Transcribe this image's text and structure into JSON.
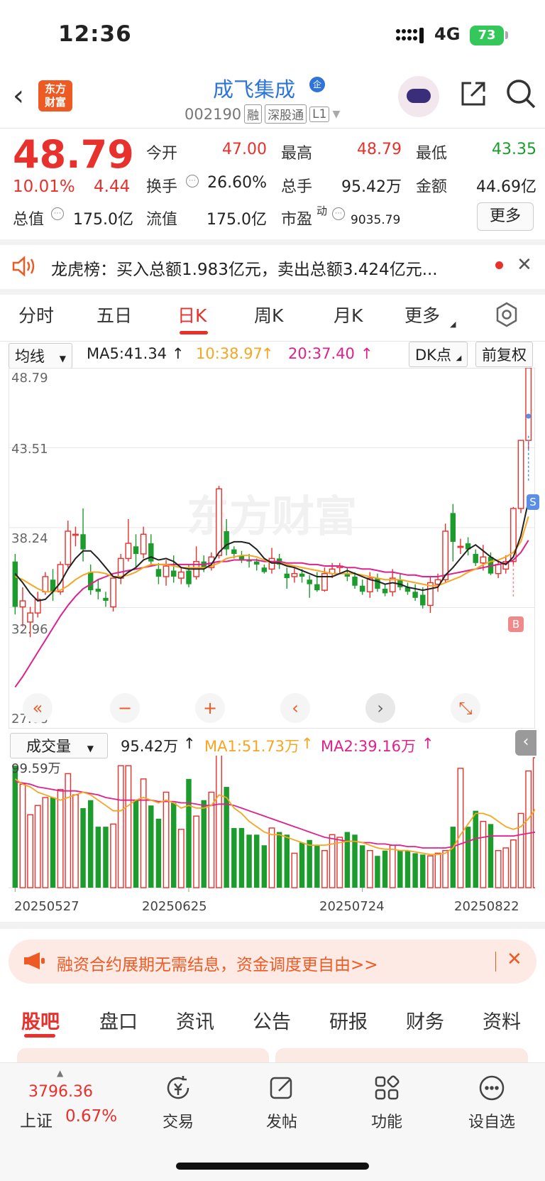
{
  "status_bar": {
    "time": "12:36",
    "network": "4G",
    "battery": "73"
  },
  "header": {
    "back": "‹",
    "logo_line1": "东方",
    "logo_line2": "财富",
    "stock_name": "成飞集成",
    "cert_badge": "企",
    "code": "002190",
    "tags": [
      "融",
      "深股通",
      "L1"
    ]
  },
  "quote": {
    "price": "48.79",
    "change_pct": "10.01%",
    "change": "4.44",
    "open_label": "今开",
    "open": "47.00",
    "high_label": "最高",
    "high": "48.79",
    "low_label": "最低",
    "low": "43.35",
    "turnover_label": "换手",
    "turnover": "26.60%",
    "volume_label": "总手",
    "volume": "95.42万",
    "amount_label": "金额",
    "amount": "44.69亿",
    "mktcap_label": "总值",
    "mktcap": "175.0亿",
    "float_label": "流值",
    "float": "175.0亿",
    "pe_label": "市盈",
    "pe_sup": "动",
    "pe": "9035.79",
    "more": "更多"
  },
  "notice": {
    "text": "龙虎榜：买入总额1.983亿元，卖出总额3.424亿元..."
  },
  "period_tabs": [
    "分时",
    "五日",
    "日K",
    "周K",
    "月K",
    "更多"
  ],
  "active_period": "日K",
  "ma_row": {
    "selector": "均线",
    "ma5": "MA5:41.34",
    "ma10": "10:38.97",
    "ma20": "20:37.40",
    "dk": "DK点",
    "adjust": "前复权",
    "colors": {
      "ma5": "#222222",
      "ma10": "#f5a623",
      "ma20": "#e0208c"
    }
  },
  "price_axis": [
    "48.79",
    "43.51",
    "38.24",
    "32.96",
    "27.68"
  ],
  "vol_row": {
    "selector": "成交量",
    "vol": "95.42万",
    "ma1": "MA1:51.73万",
    "ma2": "MA2:39.16万",
    "max_label": "99.59万"
  },
  "date_axis": [
    "20250527",
    "20250625",
    "20250724",
    "20250822"
  ],
  "markers": {
    "sell": "S",
    "buy": "B"
  },
  "controls": [
    "«",
    "−",
    "+",
    "‹",
    "›",
    "⤡"
  ],
  "ad": {
    "text": "融资合约展期无需结息，资金调度更自由>>"
  },
  "bottom_tabs": [
    "股吧",
    "盘口",
    "资讯",
    "公告",
    "研报",
    "财务",
    "资料"
  ],
  "footer": {
    "index_value": "3796.36",
    "index_name": "上证",
    "index_pct": "0.67%",
    "items": [
      {
        "label": "交易",
        "icon": "trade-icon"
      },
      {
        "label": "发帖",
        "icon": "post-icon"
      },
      {
        "label": "功能",
        "icon": "apps-icon"
      },
      {
        "label": "设自选",
        "icon": "more-dots-icon"
      }
    ]
  },
  "chart_data": {
    "type": "candlestick",
    "ylim": [
      27.68,
      48.79
    ],
    "colors": {
      "up": "#e8302c",
      "down": "#1c9c2c"
    },
    "ohlc": [
      [
        36.0,
        36.5,
        32.5,
        33.0
      ],
      [
        33.0,
        34.3,
        31.7,
        33.4
      ],
      [
        32.0,
        33.0,
        31.0,
        32.6
      ],
      [
        32.6,
        34.0,
        32.3,
        33.5
      ],
      [
        34.0,
        35.3,
        33.8,
        35.0
      ],
      [
        34.8,
        35.5,
        33.4,
        34.0
      ],
      [
        34.0,
        36.0,
        33.8,
        35.8
      ],
      [
        35.8,
        38.7,
        35.6,
        38.0
      ],
      [
        37.8,
        38.3,
        37.0,
        37.8
      ],
      [
        37.8,
        39.5,
        36.0,
        36.8
      ],
      [
        35.3,
        35.8,
        33.8,
        34.1
      ],
      [
        34.2,
        34.8,
        33.5,
        34.0
      ],
      [
        33.6,
        34.0,
        33.0,
        33.4
      ],
      [
        33.0,
        34.9,
        32.7,
        34.9
      ],
      [
        34.9,
        36.5,
        34.5,
        36.2
      ],
      [
        36.2,
        38.8,
        36.0,
        37.2
      ],
      [
        37.0,
        37.8,
        35.6,
        36.5
      ],
      [
        36.5,
        38.3,
        36.2,
        37.8
      ],
      [
        37.2,
        37.8,
        35.7,
        36.0
      ],
      [
        35.5,
        35.9,
        34.5,
        35.0
      ],
      [
        35.0,
        36.1,
        34.4,
        35.7
      ],
      [
        35.4,
        36.4,
        34.6,
        35.0
      ],
      [
        34.9,
        35.6,
        34.5,
        35.3
      ],
      [
        35.4,
        35.8,
        34.3,
        34.5
      ],
      [
        35.0,
        37.0,
        34.8,
        36.0
      ],
      [
        36.0,
        36.4,
        35.3,
        35.6
      ],
      [
        35.6,
        36.6,
        35.4,
        36.3
      ],
      [
        36.4,
        41.0,
        36.2,
        40.8
      ],
      [
        38.0,
        38.8,
        36.4,
        36.8
      ],
      [
        36.8,
        37.0,
        36.2,
        36.5
      ],
      [
        36.4,
        36.7,
        35.9,
        36.1
      ],
      [
        36.1,
        36.5,
        35.6,
        36.0
      ],
      [
        36.0,
        36.2,
        35.4,
        35.8
      ],
      [
        35.6,
        35.8,
        35.2,
        35.3
      ],
      [
        35.5,
        36.9,
        35.2,
        36.2
      ],
      [
        36.2,
        36.5,
        35.5,
        35.8
      ],
      [
        35.2,
        35.6,
        34.2,
        34.9
      ],
      [
        35.0,
        35.6,
        34.6,
        35.2
      ],
      [
        35.2,
        35.5,
        34.6,
        35.0
      ],
      [
        34.8,
        35.1,
        33.6,
        34.5
      ],
      [
        34.5,
        35.3,
        34.0,
        34.1
      ],
      [
        34.1,
        35.6,
        34.0,
        35.2
      ],
      [
        35.2,
        35.9,
        34.9,
        35.5
      ],
      [
        35.6,
        35.9,
        35.2,
        35.7
      ],
      [
        35.2,
        35.6,
        34.7,
        35.0
      ],
      [
        35.0,
        35.3,
        34.2,
        34.4
      ],
      [
        34.4,
        34.8,
        33.8,
        34.0
      ],
      [
        34.0,
        35.3,
        33.6,
        34.9
      ],
      [
        34.9,
        35.2,
        34.0,
        34.2
      ],
      [
        34.2,
        34.5,
        33.7,
        33.9
      ],
      [
        34.0,
        35.5,
        33.7,
        34.9
      ],
      [
        34.8,
        35.2,
        34.1,
        34.3
      ],
      [
        34.3,
        34.6,
        33.8,
        34.0
      ],
      [
        34.0,
        34.5,
        33.4,
        33.6
      ],
      [
        33.8,
        34.3,
        32.9,
        33.1
      ],
      [
        33.1,
        35.0,
        32.6,
        34.6
      ],
      [
        34.5,
        35.2,
        34.0,
        34.8
      ],
      [
        34.8,
        38.5,
        34.6,
        38.0
      ],
      [
        39.2,
        39.8,
        36.0,
        37.3
      ],
      [
        37.0,
        37.5,
        36.5,
        37.0
      ],
      [
        37.2,
        37.6,
        36.4,
        36.8
      ],
      [
        36.5,
        36.8,
        35.7,
        35.9
      ],
      [
        35.9,
        37.1,
        35.4,
        36.3
      ],
      [
        36.3,
        36.6,
        35.1,
        35.2
      ],
      [
        35.2,
        36.1,
        34.9,
        35.8
      ],
      [
        35.5,
        36.4,
        35.2,
        36.0
      ],
      [
        36.0,
        39.6,
        35.8,
        39.5
      ],
      [
        39.5,
        44.0,
        39.2,
        44.0
      ],
      [
        44.0,
        48.79,
        43.35,
        48.79
      ]
    ],
    "ma5": [
      35.2,
      34.6,
      33.9,
      33.4,
      33.5,
      34.0,
      34.6,
      35.5,
      36.2,
      36.7,
      36.7,
      36.2,
      35.6,
      35.0,
      34.9,
      35.3,
      35.6,
      36.1,
      36.3,
      36.1,
      36.2,
      36.0,
      35.6,
      35.5,
      35.5,
      35.5,
      35.8,
      36.6,
      37.1,
      37.3,
      37.3,
      37.2,
      36.8,
      36.2,
      35.9,
      35.9,
      35.7,
      35.6,
      35.4,
      35.2,
      35.0,
      35.0,
      35.0,
      35.2,
      35.4,
      35.2,
      35.0,
      34.8,
      34.7,
      34.5,
      34.6,
      34.5,
      34.3,
      34.2,
      34.1,
      34.2,
      34.3,
      35.1,
      35.6,
      36.2,
      36.8,
      37.1,
      36.7,
      36.3,
      36.0,
      35.8,
      36.3,
      37.7,
      40.0
    ],
    "ma10": [
      35.0,
      34.8,
      34.5,
      34.2,
      34.0,
      34.0,
      34.1,
      34.4,
      34.8,
      35.1,
      35.3,
      35.3,
      35.2,
      35.0,
      35.0,
      35.1,
      35.3,
      35.6,
      35.8,
      35.8,
      35.8,
      35.7,
      35.6,
      35.6,
      35.6,
      35.6,
      35.7,
      35.9,
      36.2,
      36.3,
      36.4,
      36.4,
      36.3,
      36.1,
      35.9,
      35.9,
      35.8,
      35.7,
      35.6,
      35.5,
      35.4,
      35.3,
      35.2,
      35.2,
      35.2,
      35.2,
      35.1,
      35.0,
      34.9,
      34.8,
      34.8,
      34.8,
      34.7,
      34.6,
      34.5,
      34.4,
      34.4,
      34.6,
      34.8,
      35.0,
      35.3,
      35.5,
      35.8,
      36.0,
      36.1,
      36.3,
      36.6,
      37.3,
      38.97
    ],
    "ma20": [
      27.7,
      28.4,
      29.2,
      30.0,
      30.8,
      31.6,
      32.4,
      33.1,
      33.7,
      34.2,
      34.5,
      34.8,
      35.0,
      35.2,
      35.3,
      35.4,
      35.5,
      35.6,
      35.7,
      35.8,
      35.8,
      35.8,
      35.8,
      35.8,
      35.8,
      35.8,
      35.9,
      36.0,
      36.0,
      36.1,
      36.1,
      36.1,
      36.1,
      36.0,
      36.0,
      36.0,
      35.9,
      35.9,
      35.9,
      35.8,
      35.8,
      35.7,
      35.7,
      35.7,
      35.6,
      35.6,
      35.5,
      35.5,
      35.4,
      35.3,
      35.3,
      35.2,
      35.1,
      35.1,
      35.0,
      35.0,
      35.0,
      35.1,
      35.2,
      35.3,
      35.4,
      35.5,
      35.6,
      35.7,
      35.8,
      35.9,
      36.1,
      36.6,
      37.4
    ],
    "volume": [
      92,
      78,
      55,
      62,
      68,
      68,
      74,
      86,
      70,
      60,
      66,
      46,
      46,
      48,
      92,
      92,
      66,
      82,
      62,
      52,
      72,
      64,
      44,
      82,
      54,
      66,
      72,
      100,
      76,
      45,
      45,
      40,
      40,
      32,
      45,
      42,
      40,
      26,
      34,
      36,
      32,
      28,
      40,
      38,
      42,
      40,
      32,
      28,
      24,
      28,
      32,
      28,
      28,
      26,
      25,
      24,
      26,
      28,
      46,
      90,
      46,
      58,
      50,
      48,
      28,
      30,
      36,
      56,
      88,
      98
    ],
    "vol_ma1": [
      82,
      78,
      76,
      72,
      70,
      68,
      66,
      68,
      70,
      72,
      70,
      66,
      62,
      58,
      58,
      62,
      66,
      68,
      66,
      64,
      66,
      64,
      60,
      62,
      60,
      60,
      62,
      70,
      68,
      60,
      56,
      50,
      46,
      42,
      40,
      40,
      38,
      36,
      34,
      32,
      32,
      32,
      33,
      34,
      35,
      35,
      34,
      32,
      30,
      29,
      29,
      28,
      28,
      27,
      26,
      25,
      25,
      26,
      30,
      40,
      48,
      56,
      56,
      54,
      50,
      46,
      44,
      46,
      52,
      60
    ],
    "vol_ma2": [
      80,
      79,
      78,
      76,
      75,
      74,
      73,
      73,
      73,
      72,
      71,
      70,
      68,
      67,
      66,
      66,
      66,
      66,
      66,
      65,
      65,
      65,
      64,
      64,
      63,
      62,
      62,
      63,
      63,
      62,
      60,
      58,
      56,
      54,
      52,
      50,
      48,
      46,
      44,
      42,
      40,
      38,
      37,
      36,
      35,
      35,
      34,
      34,
      33,
      33,
      32,
      32,
      31,
      31,
      30,
      30,
      30,
      30,
      31,
      33,
      35,
      37,
      38,
      39,
      39,
      39,
      39,
      40,
      41,
      42
    ],
    "vol_max": 99.59,
    "date_index": [
      0,
      20,
      40,
      60
    ]
  }
}
